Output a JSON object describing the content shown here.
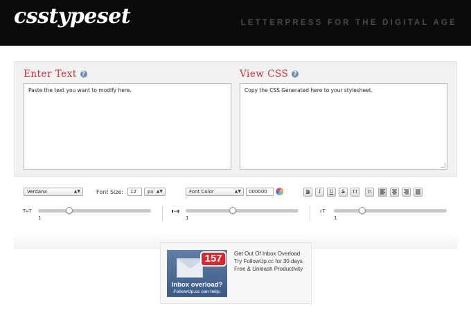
{
  "header": {
    "logo": "csstypeset",
    "tagline": "LETTERPRESS FOR THE DIGITAL AGE"
  },
  "editor": {
    "enter_title": "Enter Text",
    "view_title": "View CSS",
    "help_glyph": "?",
    "input_value": "Paste the text you want to modify here.",
    "output_value": "Copy the CSS Generated here to your stylesheet."
  },
  "toolbar": {
    "font_family": "Verdana",
    "font_size_label": "Font Size:",
    "font_size_value": "12",
    "font_unit": "px",
    "font_color_label": "Font Color",
    "font_color_value": "000000",
    "format_buttons": [
      "B",
      "I",
      "U",
      "S",
      "TT",
      "Tt",
      "left",
      "center",
      "right",
      "justify"
    ],
    "active_format": "left",
    "dropdown_arrow": "▲▼"
  },
  "sliders": [
    {
      "name": "letter-spacing",
      "icon": "T↔T",
      "value": "1",
      "position": 0.3
    },
    {
      "name": "word-spacing",
      "icon": "▮↔▮",
      "value": "1",
      "position": 0.42
    },
    {
      "name": "line-height",
      "icon": "↕T",
      "value": "1",
      "position": 0.25
    }
  ],
  "ad": {
    "badge": "157",
    "image_headline": "Inbox overload?",
    "image_sub": "FollowUp.cc can help.",
    "line1": "Get Out Of Inbox Overload",
    "line2": "Try FollowUp.cc for 30 days",
    "line3": "Free & Unleash Productivity"
  },
  "colors": {
    "header_bg": "#0b0b0b",
    "title_red": "#c7343a",
    "panel_bg": "#f1f1f1",
    "ad_blue": "#3b5a85"
  }
}
